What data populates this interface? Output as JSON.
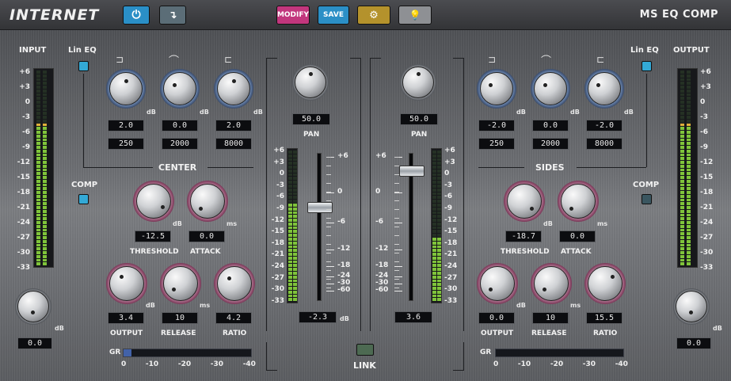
{
  "brand": "INTERNET",
  "plugin_title": "MS EQ COMP",
  "toolbar": {
    "modify": "MODIFY",
    "save": "SAVE"
  },
  "input": {
    "label": "INPUT",
    "gain": "0.0",
    "unit": "dB"
  },
  "output": {
    "label": "OUTPUT",
    "gain": "0.0",
    "unit": "dB"
  },
  "lin_eq_label": "Lin EQ",
  "comp_label": "COMP",
  "meter_scale": [
    "+6",
    "+3",
    "0",
    "-3",
    "-6",
    "-9",
    "-12",
    "-15",
    "-18",
    "-21",
    "-24",
    "-27",
    "-30",
    "-33"
  ],
  "fader_scale": [
    "+6",
    "0",
    "-6",
    "-12",
    "-18",
    "-24",
    "-30",
    "-60"
  ],
  "center": {
    "title": "CENTER",
    "eq_gains": [
      "2.0",
      "0.0",
      "2.0"
    ],
    "eq_freqs": [
      "250",
      "2000",
      "8000"
    ],
    "pan": "50.0",
    "pan_label": "PAN",
    "threshold": "-12.5",
    "attack": "0.0",
    "output": "3.4",
    "release": "10",
    "ratio": "4.2",
    "fader": "-2.3",
    "gr_level": 0.06
  },
  "sides": {
    "title": "SIDES",
    "eq_gains": [
      "-2.0",
      "0.0",
      "-2.0"
    ],
    "eq_freqs": [
      "250",
      "2000",
      "8000"
    ],
    "pan": "50.0",
    "pan_label": "PAN",
    "threshold": "-18.7",
    "attack": "0.0",
    "output": "0.0",
    "release": "10",
    "ratio": "15.5",
    "fader": "3.6",
    "gr_level": 0.0
  },
  "labels": {
    "threshold": "THRESHOLD",
    "attack": "ATTACK",
    "output": "OUTPUT",
    "release": "RELEASE",
    "ratio": "RATIO",
    "db": "dB",
    "ms": "ms",
    "gr": "GR",
    "link": "LINK"
  },
  "gr_scale": [
    "0",
    "-10",
    "-20",
    "-30",
    "-40"
  ],
  "colors": {
    "led_blue": "#33a9d6",
    "modify": "#c2367d",
    "save": "#2b8fc6",
    "settings": "#b4922c",
    "power": "#2a8fc7"
  }
}
